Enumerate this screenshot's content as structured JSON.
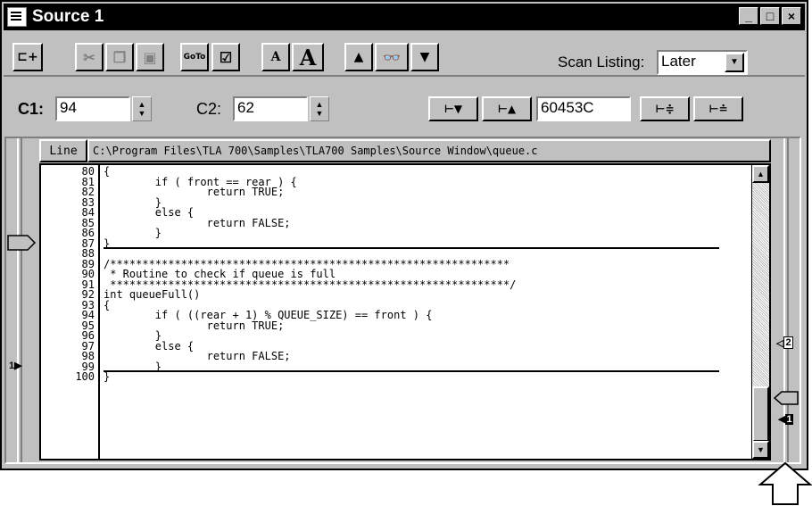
{
  "window": {
    "title": "Source 1",
    "buttons": {
      "minimize": "_",
      "maximize": "□",
      "close": "×"
    }
  },
  "toolbar": {
    "items": [
      {
        "name": "new-marker",
        "label": "⊏+",
        "enabled": true
      },
      {
        "name": "cut",
        "label": "✂",
        "enabled": false
      },
      {
        "name": "copy",
        "label": "❐",
        "enabled": false
      },
      {
        "name": "paste",
        "label": "▣",
        "enabled": false
      },
      {
        "name": "goto",
        "label": "GoTo",
        "enabled": true
      },
      {
        "name": "properties",
        "label": "☑",
        "enabled": true
      },
      {
        "name": "font-smaller",
        "label": "A",
        "enabled": true
      },
      {
        "name": "font-larger",
        "label": "A",
        "enabled": true
      },
      {
        "name": "search-up",
        "label": "▲",
        "enabled": true
      },
      {
        "name": "find",
        "label": "👓",
        "enabled": true
      },
      {
        "name": "search-down",
        "label": "▼",
        "enabled": true
      }
    ],
    "scan_label": "Scan Listing:",
    "scan_value": "Later"
  },
  "cursors": {
    "c1_label": "C1:",
    "c1_value": "94",
    "c2_label": "C2:",
    "c2_value": "62",
    "address_value": "60453C",
    "nav": [
      "⊢▼",
      "⊢▲",
      "⊢≑",
      "⊢≐"
    ]
  },
  "source": {
    "line_header": "Line",
    "path": "C:\\Program Files\\TLA 700\\Samples\\TLA700 Samples\\Source Window\\queue.c",
    "lines": [
      {
        "n": "80",
        "t": "{"
      },
      {
        "n": "81",
        "t": "        if ( front == rear ) {"
      },
      {
        "n": "82",
        "t": "                return TRUE;"
      },
      {
        "n": "83",
        "t": "        }"
      },
      {
        "n": "84",
        "t": "        else {"
      },
      {
        "n": "85",
        "t": "                return FALSE;"
      },
      {
        "n": "86",
        "t": "        }"
      },
      {
        "n": "87",
        "t": "}"
      },
      {
        "n": "88",
        "t": ""
      },
      {
        "n": "89",
        "t": "/**************************************************************"
      },
      {
        "n": "90",
        "t": " * Routine to check if queue is full"
      },
      {
        "n": "91",
        "t": " **************************************************************/"
      },
      {
        "n": "92",
        "t": "int queueFull()"
      },
      {
        "n": "93",
        "t": "{"
      },
      {
        "n": "94",
        "t": "        if ( ((rear + 1) % QUEUE_SIZE) == front ) {"
      },
      {
        "n": "95",
        "t": "                return TRUE;"
      },
      {
        "n": "96",
        "t": "        }"
      },
      {
        "n": "97",
        "t": "        else {"
      },
      {
        "n": "98",
        "t": "                return FALSE;"
      },
      {
        "n": "99",
        "t": "        }"
      },
      {
        "n": "100",
        "t": "}"
      }
    ]
  },
  "markers": {
    "left_cursor": "1",
    "right_c2": "2",
    "right_c1": "1"
  }
}
